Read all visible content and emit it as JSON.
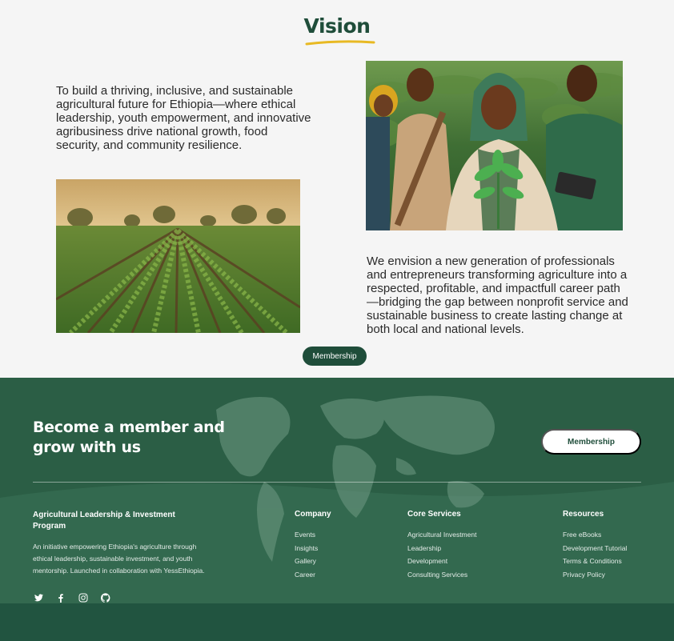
{
  "vision": {
    "title": "Vision",
    "paragraph1": "To build a thriving, inclusive, and sustainable agricultural future for Ethiopia—where ethical leadership, youth empowerment, and innovative agribusiness drive national growth, food security, and community resilience.",
    "paragraph2": "We envision a new generation of professionals and entrepreneurs transforming agriculture into a respected, profitable, and impactfull career path—bridging the gap between nonprofit service and sustainable business to create lasting change at both local and national levels.",
    "membership_label": "Membership",
    "colors": {
      "brand_green": "#1f4d3a",
      "accent_yellow": "#e8b923",
      "background": "#f5f5f5"
    }
  },
  "footer": {
    "cta_title": "Become a member and grow with us",
    "membership_label": "Membership",
    "org_name": "Agricultural Leadership & Investment Program",
    "org_description": "An initiative empowering Ethiopia's agriculture through ethical leadership, sustainable investment, and youth mentorship. Launched in collaboration with YessEthiopia.",
    "socials": [
      "twitter-icon",
      "facebook-icon",
      "instagram-icon",
      "github-icon"
    ],
    "columns": [
      {
        "heading": "Company",
        "links": [
          "Events",
          "Insights",
          "Gallery",
          "Career"
        ]
      },
      {
        "heading": "Core Services",
        "links": [
          "Agricultural Investment",
          "Leadership",
          "Development",
          "Consulting Services"
        ]
      },
      {
        "heading": "Resources",
        "links": [
          "Free eBooks",
          "Development Tutorial",
          "Terms & Conditions",
          "Privacy Policy"
        ]
      }
    ],
    "colors": {
      "background": "#225540",
      "text": "#ffffff"
    }
  }
}
